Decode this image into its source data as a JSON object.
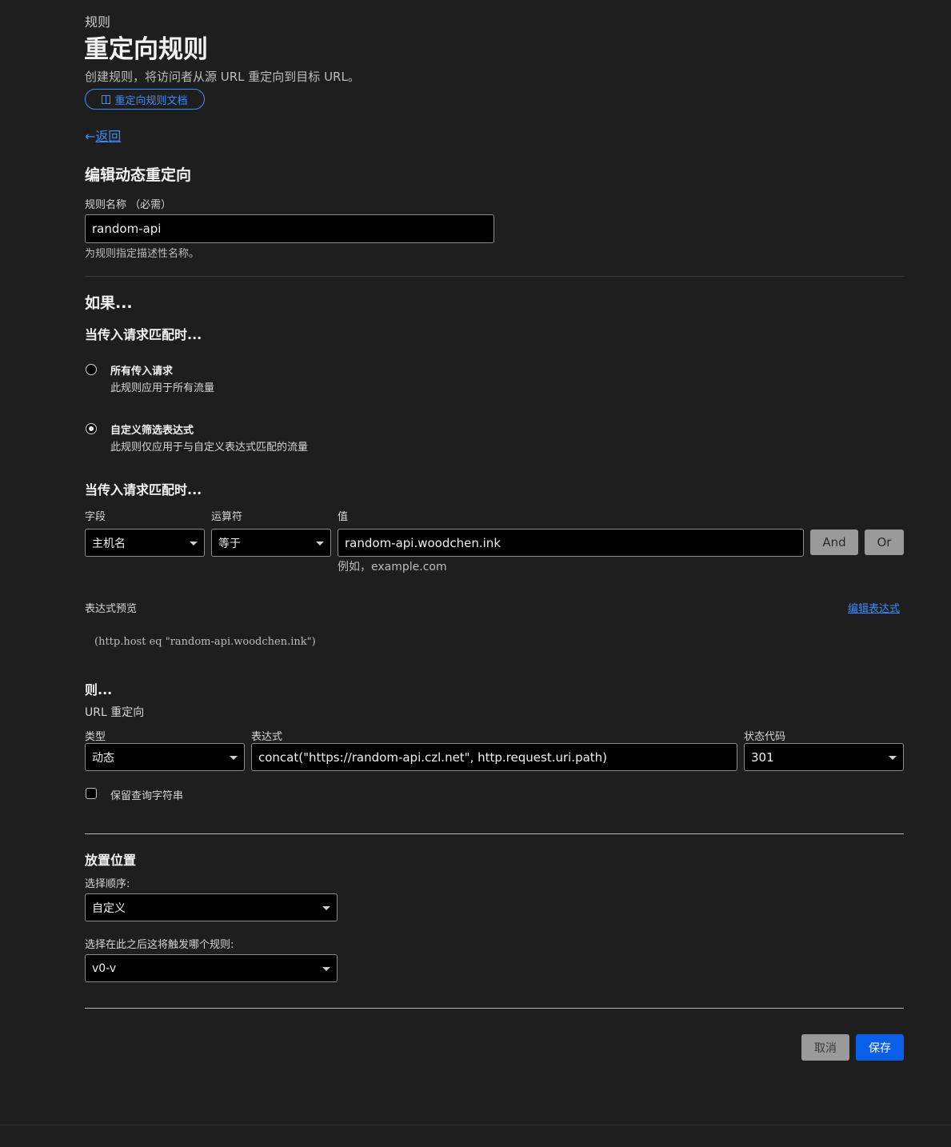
{
  "header": {
    "breadcrumb": "规则",
    "title": "重定向规则",
    "description": "创建规则，将访问者从源 URL 重定向到目标 URL。",
    "docs_link": "重定向规则文档",
    "back_arrow": "←",
    "back_label": "返回"
  },
  "edit": {
    "heading": "编辑动态重定向",
    "name_label": "规则名称 （必需）",
    "name_value": "random-api",
    "name_help": "为规则指定描述性名称。"
  },
  "if_section": {
    "heading": "如果...",
    "match_heading": "当传入请求匹配时...",
    "options": [
      {
        "title": "所有传入请求",
        "desc": "此规则应用于所有流量",
        "selected": false
      },
      {
        "title": "自定义筛选表达式",
        "desc": "此规则仅应用于与自定义表达式匹配的流量",
        "selected": true
      }
    ],
    "match_heading2": "当传入请求匹配时...",
    "field_label": "字段",
    "field_value": "主机名",
    "operator_label": "运算符",
    "operator_value": "等于",
    "value_label": "值",
    "value_value": "random-api.woodchen.ink",
    "value_help": "例如，example.com",
    "and_label": "And",
    "or_label": "Or",
    "preview_label": "表达式预览",
    "edit_expression": "编辑表达式",
    "preview_code": "(http.host eq \"random-api.woodchen.ink\")"
  },
  "then_section": {
    "heading": "则...",
    "subheading": "URL 重定向",
    "type_label": "类型",
    "type_value": "动态",
    "expr_label": "表达式",
    "expr_value": "concat(\"https://random-api.czl.net\", http.request.uri.path)",
    "status_label": "状态代码",
    "status_value": "301",
    "preserve_label": "保留查询字符串",
    "preserve_checked": false
  },
  "placement": {
    "heading": "放置位置",
    "order_label": "选择顺序:",
    "order_value": "自定义",
    "after_label": "选择在此之后这将触发哪个规则:",
    "after_value": "v0-v"
  },
  "footer": {
    "cancel": "取消",
    "save": "保存"
  },
  "colors": {
    "background": "#1e1e1e",
    "accent": "#0a5fe8",
    "link": "#3b8cff"
  }
}
